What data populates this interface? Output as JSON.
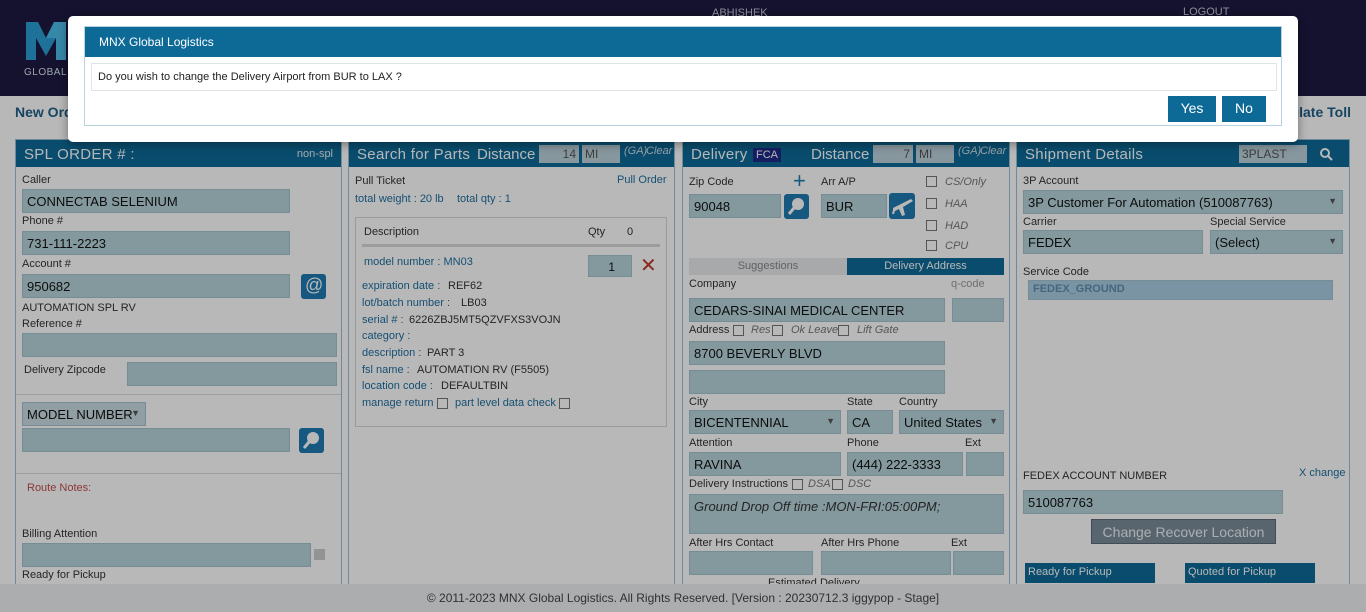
{
  "header": {
    "logo_text": "GLOBAL",
    "user": "ABHISHEK",
    "logout": "LOGOUT",
    "new_order": "New Ord",
    "calc_toll": "ulate Toll"
  },
  "spl": {
    "title": "SPL ORDER # :",
    "tag": "non-spl",
    "caller_label": "Caller",
    "caller": "CONNECTAB SELENIUM",
    "phone_label": "Phone #",
    "phone": "731-111-2223",
    "account_label": "Account #",
    "account": "950682",
    "account_name": "AUTOMATION SPL RV",
    "reference_label": "Reference #",
    "reference": "",
    "zipcode_label": "Delivery Zipcode",
    "zipcode": "",
    "model_select": "MODEL NUMBER",
    "model_value": "",
    "route_notes": "Route Notes:",
    "billing_label": "Billing Attention",
    "billing": "",
    "ready_label": "Ready for Pickup"
  },
  "parts": {
    "title": "Search for Parts",
    "distance_label": "Distance",
    "distance": "14",
    "unit": "MI",
    "ga": "(GA)",
    "clear": "Clear",
    "pull_ticket": "Pull Ticket",
    "pull_order": "Pull Order",
    "total_weight": "total weight : 20 lb",
    "total_qty": "total qty : 1",
    "col_description": "Description",
    "col_qty": "Qty",
    "col_qty_total": "0",
    "item": {
      "model_number": "model number : MN03",
      "qty": "1",
      "expiration_label": "expiration date :",
      "expiration": "REF62",
      "lot_label": "lot/batch number :",
      "lot": "LB03",
      "serial_label": "serial # :",
      "serial": "6226ZBJ5MT5QZVFXS3VOJN",
      "category_label": "category :",
      "description_label": "description :",
      "description": "PART 3",
      "fsl_label": "fsl name :",
      "fsl": "AUTOMATION RV (F5505)",
      "location_label": "location code :",
      "location": "DEFAULTBIN",
      "manage_return": "manage return",
      "part_level": "part level data check"
    }
  },
  "delivery": {
    "title": "Delivery",
    "badge": "FCA",
    "distance_label": "Distance",
    "distance": "7",
    "unit": "MI",
    "ga": "(GA)",
    "clear": "Clear",
    "zip_label": "Zip Code",
    "zip": "90048",
    "arr_label": "Arr A/P",
    "arr": "BUR",
    "cs_only": "CS/Only",
    "haa": "HAA",
    "had": "HAD",
    "cpu": "CPU",
    "tab_suggestions": "Suggestions",
    "tab_address": "Delivery Address",
    "company_label": "Company",
    "qcode_label": "q-code",
    "company": "CEDARS-SINAI MEDICAL CENTER",
    "address_label": "Address",
    "res": "Res",
    "ok_leave": "Ok Leave",
    "lift_gate": "Lift Gate",
    "address1": "8700 BEVERLY BLVD",
    "address2": "",
    "city_label": "City",
    "state_label": "State",
    "country_label": "Country",
    "city": "BICENTENNIAL",
    "state": "CA",
    "country": "United States",
    "attention_label": "Attention",
    "phone_label": "Phone",
    "ext_label": "Ext",
    "attention": "RAVINA",
    "phone": "(444) 222-3333",
    "instructions_label": "Delivery Instructions",
    "dsa": "DSA",
    "dsc": "DSC",
    "instructions": "Ground Drop Off time :MON-FRI:05:00PM;",
    "after_contact_label": "After Hrs Contact",
    "after_phone_label": "After Hrs Phone",
    "after_ext_label": "Ext",
    "estimated": "Estimated Delivery"
  },
  "shipment": {
    "title": "Shipment Details",
    "search_value": "3PLAST",
    "account_label": "3P Account",
    "account": "3P Customer For Automation (510087763)",
    "carrier_label": "Carrier",
    "carrier": "FEDEX",
    "special_label": "Special Service",
    "special": "(Select)",
    "service_label": "Service Code",
    "service": "FEDEX_GROUND",
    "fedex_label": "FEDEX ACCOUNT NUMBER",
    "x_change": "X change",
    "fedex_account": "510087763",
    "change_recover": "Change Recover Location",
    "ready_pickup": "Ready for Pickup",
    "quoted_pickup": "Quoted for Pickup"
  },
  "modal": {
    "title": "MNX Global Logistics",
    "message": "Do you wish to change the Delivery Airport from BUR to LAX ?",
    "yes": "Yes",
    "no": "No"
  },
  "footer": {
    "text": "© 2011-2023 MNX Global Logistics. All Rights Reserved. [Version : 20230712.3 iggypop - Stage]"
  },
  "colors": {
    "brand_header": "#1c1942",
    "panel_header": "#0d6a97",
    "field_bg": "#b8d4dc",
    "accent_red": "#c0392b"
  }
}
